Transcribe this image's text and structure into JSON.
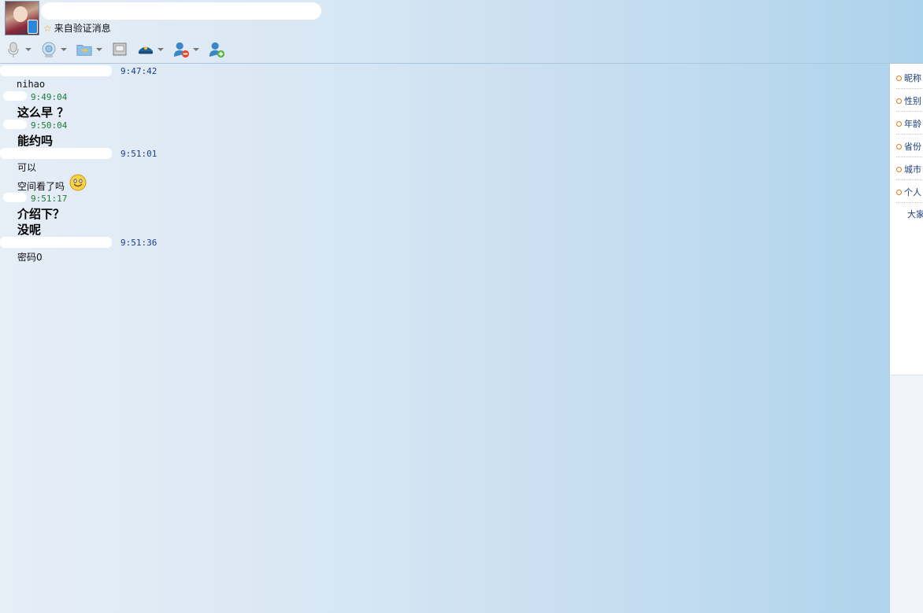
{
  "header": {
    "verify_text": "来自验证消息"
  },
  "toolbar": {
    "items": [
      {
        "name": "voice-call-button",
        "icon": "microphone-icon"
      },
      {
        "name": "video-call-button",
        "icon": "webcam-icon"
      },
      {
        "name": "send-file-button",
        "icon": "folder-icon"
      },
      {
        "name": "remote-desktop-button",
        "icon": "screen-icon"
      },
      {
        "name": "application-button",
        "icon": "app-hat-icon"
      },
      {
        "name": "block-user-button",
        "icon": "user-remove-icon"
      },
      {
        "name": "add-friend-button",
        "icon": "user-add-icon"
      }
    ]
  },
  "messages": [
    {
      "time": "9:47:42",
      "lines": [
        "nihao"
      ]
    },
    {
      "time": "9:49:04",
      "lines": [
        "这么早 ？"
      ]
    },
    {
      "time": "9:50:04",
      "lines": [
        "能约吗"
      ]
    },
    {
      "time": "9:51:01",
      "lines": [
        "可以",
        "空间看了吗"
      ]
    },
    {
      "time": "9:51:17",
      "lines": [
        "介绍下？",
        "没呢"
      ]
    },
    {
      "time": "9:51:36",
      "lines": [
        "密码0"
      ]
    }
  ],
  "profile_panel": {
    "fields": [
      "昵称",
      "性别",
      "年龄",
      "省份",
      "城市",
      "个人"
    ],
    "footer": "大家"
  },
  "colors": {
    "time_self": "#1b3f8e",
    "time_other": "#1f7a3b",
    "accent_orange": "#e07a18"
  }
}
